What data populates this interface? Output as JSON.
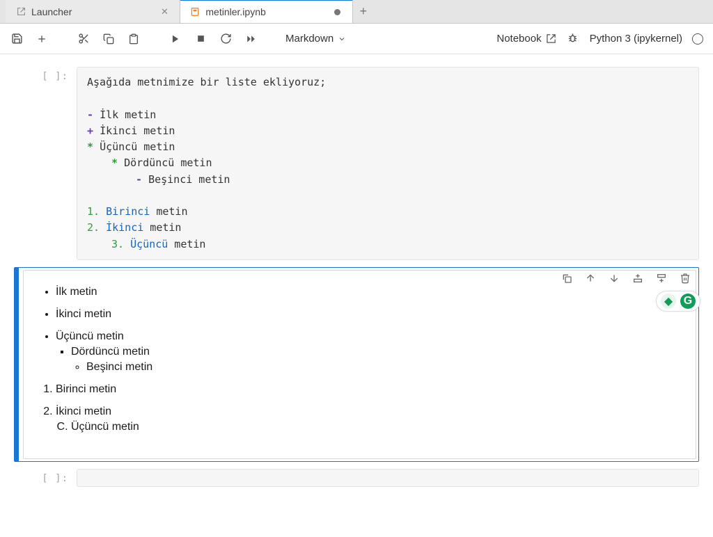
{
  "tabs": {
    "launcher": "Launcher",
    "notebook": "metinler.ipynb"
  },
  "toolbar": {
    "celltype": "Markdown",
    "trusted": "Notebook",
    "kernel": "Python 3 (ipykernel)"
  },
  "raw": {
    "intro": "Aşağıda metnimize bir liste ekliyoruz;",
    "l1": "İlk metin",
    "l2": "İkinci metin",
    "l3": "Üçüncü metin",
    "l4": "Dördüncü metin",
    "l5": "Beşinci metin",
    "o1w": "Birinci",
    "o1r": " metin",
    "o2w": "İkinci",
    "o2r": " metin",
    "o3w": "Üçüncü",
    "o3r": " metin",
    "n1": "1.",
    "n2": "2.",
    "n3": "3."
  },
  "rendered": {
    "u1": "İlk metin",
    "u2": "İkinci metin",
    "u3": "Üçüncü metin",
    "u4": "Dördüncü metin",
    "u5": "Beşinci metin",
    "o1": "Birinci metin",
    "o2": "İkinci metin",
    "o3": "Üçüncü metin"
  },
  "prompt": "[ ]:"
}
